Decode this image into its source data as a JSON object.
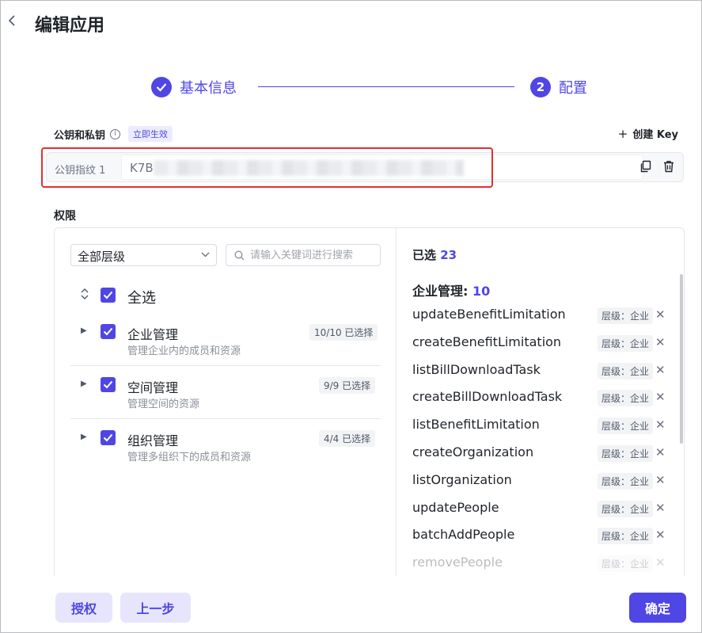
{
  "header": {
    "back_icon": "chevron-left-icon",
    "title": "编辑应用"
  },
  "steps": [
    {
      "label": "基本信息",
      "status": "done",
      "icon": "check-circle-icon"
    },
    {
      "number": "2",
      "label": "配置",
      "status": "active"
    }
  ],
  "keys": {
    "title": "公钥和私钥",
    "badge": "立即生效",
    "create_label": "创建 Key",
    "fingerprint_label": "公钥指纹 1",
    "fingerprint_value": "K7B"
  },
  "permissions": {
    "title": "权限",
    "level_select": "全部层级",
    "search_placeholder": "请输入关键词进行搜索",
    "select_all": "全选",
    "groups": [
      {
        "name": "企业管理",
        "desc": "管理企业内的成员和资源",
        "count": "10/10 已选择"
      },
      {
        "name": "空间管理",
        "desc": "管理空间的资源",
        "count": "9/9 已选择"
      },
      {
        "name": "组织管理",
        "desc": "管理多组织下的成员和资源",
        "count": "4/4 已选择"
      }
    ],
    "selected_label": "已选",
    "selected_count": "23",
    "category_label": "企业管理:",
    "category_count": "10",
    "items": [
      {
        "name": "updateBenefitLimitation",
        "level": "层级：企业"
      },
      {
        "name": "createBenefitLimitation",
        "level": "层级：企业"
      },
      {
        "name": "listBillDownloadTask",
        "level": "层级：企业"
      },
      {
        "name": "createBillDownloadTask",
        "level": "层级：企业"
      },
      {
        "name": "listBenefitLimitation",
        "level": "层级：企业"
      },
      {
        "name": "createOrganization",
        "level": "层级：企业"
      },
      {
        "name": "listOrganization",
        "level": "层级：企业"
      },
      {
        "name": "updatePeople",
        "level": "层级：企业"
      },
      {
        "name": "batchAddPeople",
        "level": "层级：企业"
      },
      {
        "name": "removePeople",
        "level": "层级：企业"
      }
    ]
  },
  "footer": {
    "authorize": "授权",
    "previous": "上一步",
    "confirm": "确定"
  },
  "colors": {
    "accent": "#4f46e5",
    "highlight_border": "#e0302f"
  }
}
